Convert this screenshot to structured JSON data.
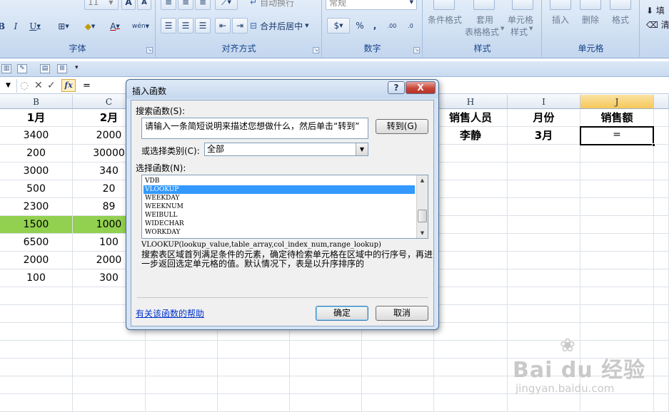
{
  "ribbon": {
    "font_size_value": "11",
    "font_group_label": "字体",
    "align_group_label": "对齐方式",
    "wrap_text_label": "自动换行",
    "merge_center_label": "合并后居中",
    "number_format_value": "常规",
    "number_group_label": "数字",
    "percent_symbol": "%",
    "comma_symbol": ",",
    "cond_format_label": "条件格式",
    "table_format_label_1": "套用",
    "table_format_label_2": "表格格式",
    "cell_style_label_1": "单元格",
    "cell_style_label_2": "样式",
    "styles_group_label": "样式",
    "insert_label": "插入",
    "delete_label": "删除",
    "format_label": "格式",
    "cells_group_label": "单元格",
    "fill_label": "填",
    "clear_label": "清"
  },
  "formula_bar": {
    "fx_label": "fx",
    "content": "="
  },
  "grid": {
    "col_headers": [
      "B",
      "C",
      "H",
      "I",
      "J"
    ],
    "rows": [
      {
        "b": "1月",
        "c": "2月"
      },
      {
        "b": "3400",
        "c": "2000"
      },
      {
        "b": "200",
        "c": "30000"
      },
      {
        "b": "3000",
        "c": "340"
      },
      {
        "b": "500",
        "c": "20"
      },
      {
        "b": "2300",
        "c": "89"
      },
      {
        "b": "1500",
        "c": "1000"
      },
      {
        "b": "6500",
        "c": "100"
      },
      {
        "b": "2000",
        "c": "2000"
      },
      {
        "b": "100",
        "c": "300"
      }
    ],
    "h_header": "销售人员",
    "i_header": "月份",
    "j_header": "销售额",
    "h_value": "李静",
    "i_value": "3月",
    "j_value": "=",
    "highlight_color": "#92d050"
  },
  "dialog": {
    "title": "插入函数",
    "help_btn": "?",
    "close_btn": "X",
    "search_label": "搜索函数(S):",
    "search_value": "请输入一条简短说明来描述您想做什么，然后单击“转到”",
    "go_btn": "转到(G)",
    "category_label": "或选择类别(C):",
    "category_value": "全部",
    "func_label": "选择函数(N):",
    "functions": [
      "VDB",
      "VLOOKUP",
      "WEEKDAY",
      "WEEKNUM",
      "WEIBULL",
      "WIDECHAR",
      "WORKDAY"
    ],
    "selected_function": "VLOOKUP",
    "syntax": "VLOOKUP(lookup_value,table_array,col_index_num,range_lookup)",
    "description": "搜索表区域首列满足条件的元素，确定待检索单元格在区域中的行序号，再进一步返回选定单元格的值。默认情况下，表是以升序排序的",
    "help_link": "有关该函数的帮助",
    "ok_btn": "确定",
    "cancel_btn": "取消"
  },
  "watermark": {
    "brand": "Bai du 经验",
    "url": "jingyan.baidu.com"
  }
}
